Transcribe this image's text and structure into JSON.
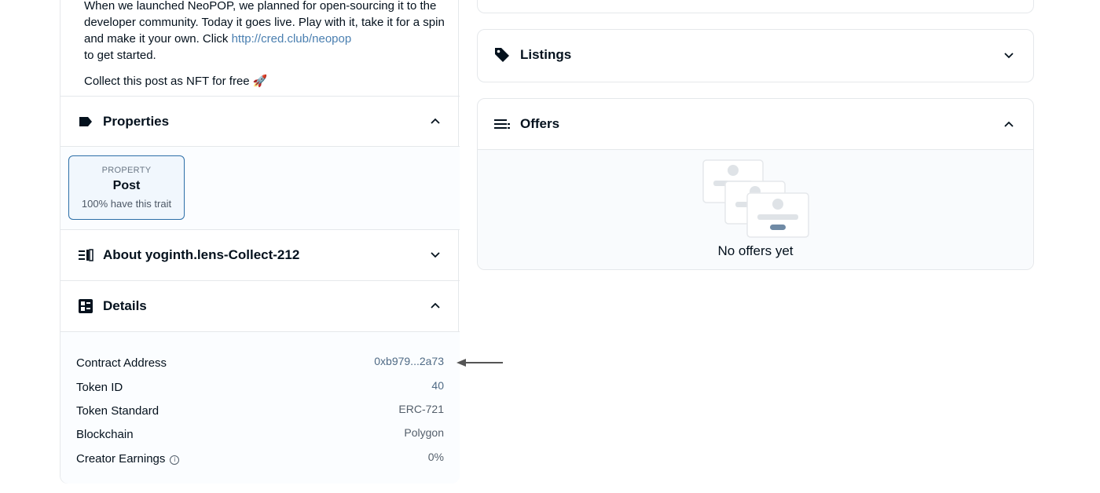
{
  "description": {
    "text": "When we launched NeoPOP, we planned for open-sourcing it to the developer community. Today it goes live. Play with it, take it for a spin and make it your own. Click ",
    "link": "http://cred.club/neopop",
    "tail": "to get started.",
    "collect_line": "Collect this post as NFT for free 🚀"
  },
  "properties": {
    "title": "Properties",
    "items": [
      {
        "type": "PROPERTY",
        "value": "Post",
        "rarity": "100% have this trait"
      }
    ]
  },
  "about": {
    "title": "About yoginth.lens-Collect-212"
  },
  "details": {
    "title": "Details",
    "rows": [
      {
        "label": "Contract Address",
        "value": "0xb979...2a73"
      },
      {
        "label": "Token ID",
        "value": "40"
      },
      {
        "label": "Token Standard",
        "value": "ERC-721"
      },
      {
        "label": "Blockchain",
        "value": "Polygon"
      },
      {
        "label": "Creator Earnings",
        "value": "0%"
      }
    ],
    "info_icon_glyph": "i"
  },
  "listings": {
    "title": "Listings"
  },
  "offers": {
    "title": "Offers",
    "empty_text": "No offers yet"
  },
  "colors": {
    "link": "#4a7fb0",
    "border": "#e5e8eb",
    "accent_card": "#2d6fa8"
  }
}
